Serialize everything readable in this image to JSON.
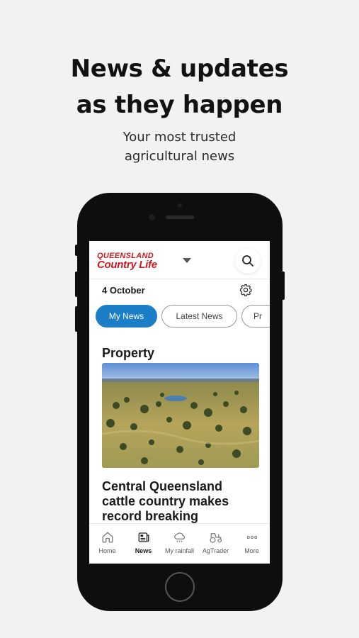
{
  "promo": {
    "headline_line1": "News & updates",
    "headline_line2": "as they happen",
    "subhead_line1": "Your most trusted",
    "subhead_line2": "agricultural news"
  },
  "app": {
    "logo_top": "QUEENSLAND",
    "logo_bottom": "Country Life",
    "date": "4 October",
    "tabs": [
      {
        "label": "My News",
        "active": true
      },
      {
        "label": "Latest News",
        "active": false
      },
      {
        "label": "Pr",
        "active": false
      }
    ],
    "section_title": "Property",
    "article": {
      "title": "Central Queensland cattle country makes record breaking"
    },
    "nav": [
      {
        "label": "Home",
        "icon": "home-icon",
        "active": false
      },
      {
        "label": "News",
        "icon": "news-icon",
        "active": true
      },
      {
        "label": "My rainfall",
        "icon": "rain-cloud-icon",
        "active": false
      },
      {
        "label": "AgTrader",
        "icon": "tractor-icon",
        "active": false
      },
      {
        "label": "More",
        "icon": "more-icon",
        "active": false
      }
    ]
  },
  "colors": {
    "brand_red": "#cc1b22",
    "accent_blue": "#1b7ec7",
    "background": "#f2f2f2"
  }
}
